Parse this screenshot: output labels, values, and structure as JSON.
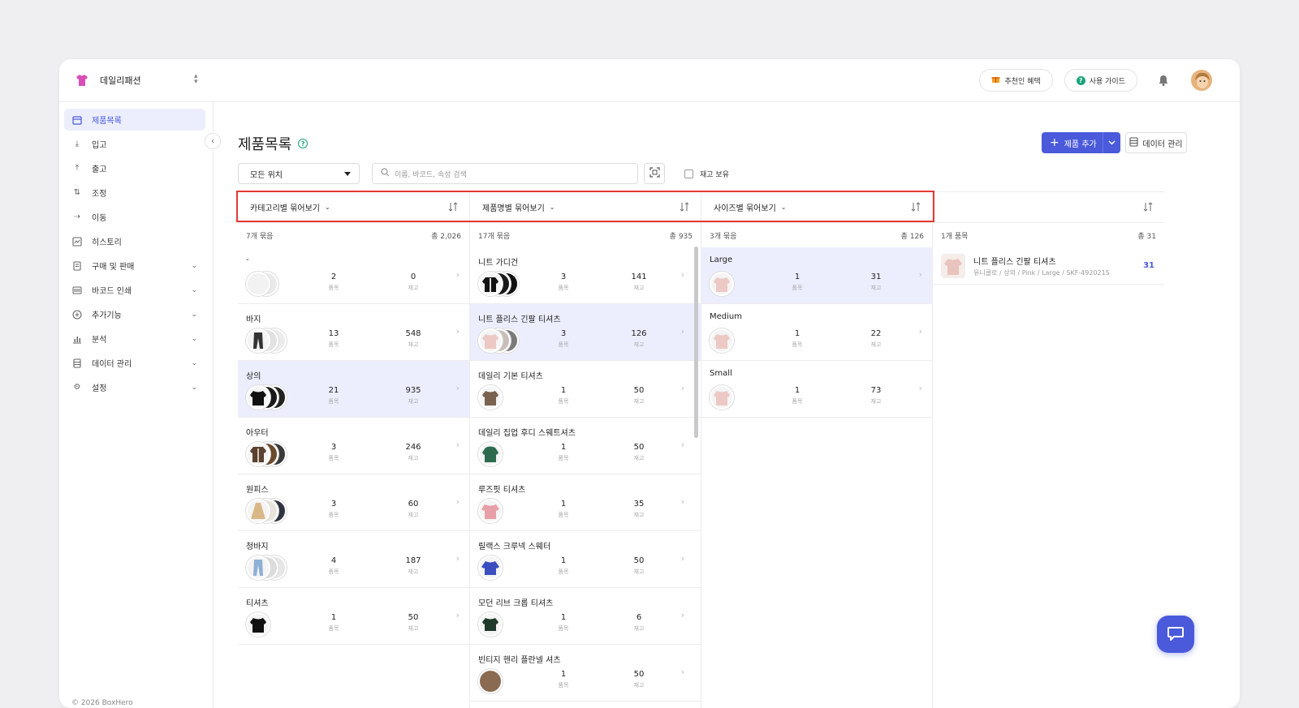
{
  "brand": {
    "name": "데일리패션"
  },
  "header": {
    "referral_label": "추천인 혜택",
    "guide_label": "사용 가이드"
  },
  "sidebar": {
    "items": [
      {
        "label": "제품목록",
        "icon": "box-icon"
      },
      {
        "label": "입고",
        "icon": "arrow-down-icon"
      },
      {
        "label": "출고",
        "icon": "arrow-up-icon"
      },
      {
        "label": "조정",
        "icon": "swap-icon"
      },
      {
        "label": "이동",
        "icon": "move-icon"
      },
      {
        "label": "히스토리",
        "icon": "history-icon"
      },
      {
        "label": "구매 및 판매",
        "icon": "document-icon"
      },
      {
        "label": "바코드 인쇄",
        "icon": "barcode-icon"
      },
      {
        "label": "추가기능",
        "icon": "plus-circle-icon"
      },
      {
        "label": "분석",
        "icon": "chart-icon"
      },
      {
        "label": "데이터 관리",
        "icon": "database-icon"
      },
      {
        "label": "설정",
        "icon": "gear-icon"
      }
    ],
    "copyright": "© 2026 BoxHero"
  },
  "page": {
    "title": "제품목록",
    "add_product_label": "제품 추가",
    "data_manage_label": "데이터 관리",
    "location_value": "모든 위치",
    "search_placeholder": "이름, 바코드, 속성 검색",
    "stock_only_label": "재고 보유"
  },
  "columns": {
    "category": {
      "header": "카테고리별 묶어보기",
      "count": "7개 묶음",
      "total": "총 2,026",
      "rows": [
        {
          "name": "-",
          "items": "2",
          "stock": "0"
        },
        {
          "name": "바지",
          "items": "13",
          "stock": "548"
        },
        {
          "name": "상의",
          "items": "21",
          "stock": "935"
        },
        {
          "name": "아우터",
          "items": "3",
          "stock": "246"
        },
        {
          "name": "원피스",
          "items": "3",
          "stock": "60"
        },
        {
          "name": "청바지",
          "items": "4",
          "stock": "187"
        },
        {
          "name": "티셔츠",
          "items": "1",
          "stock": "50"
        }
      ]
    },
    "product": {
      "header": "제품명별 묶어보기",
      "count": "17개 묶음",
      "total": "총 935",
      "rows": [
        {
          "name": "니트 가디건",
          "items": "3",
          "stock": "141"
        },
        {
          "name": "니트 플리스 긴팔 티셔츠",
          "items": "3",
          "stock": "126"
        },
        {
          "name": "데일리 기본 티셔츠",
          "items": "1",
          "stock": "50"
        },
        {
          "name": "데일리 집업 후디 스웨트셔츠",
          "items": "1",
          "stock": "50"
        },
        {
          "name": "루즈핏 티셔츠",
          "items": "1",
          "stock": "35"
        },
        {
          "name": "릴랙스 크루넥 스웨터",
          "items": "1",
          "stock": "50"
        },
        {
          "name": "모던 리브 크롭 티셔츠",
          "items": "1",
          "stock": "6"
        },
        {
          "name": "빈티지 헨리 플란넬 셔츠",
          "items": "1",
          "stock": "50"
        }
      ]
    },
    "size": {
      "header": "사이즈별 묶어보기",
      "count": "3개 묶음",
      "total": "총 126",
      "rows": [
        {
          "name": "Large",
          "items": "1",
          "stock": "31"
        },
        {
          "name": "Medium",
          "items": "1",
          "stock": "22"
        },
        {
          "name": "Small",
          "items": "1",
          "stock": "73"
        }
      ]
    },
    "items": {
      "count": "1개 품목",
      "total": "총 31",
      "rows": [
        {
          "name": "니트 플리스 긴팔 티셔츠",
          "meta": "유니클로 / 상의 / Pink / Large / SKF-4920215",
          "qty": "31"
        }
      ]
    }
  },
  "labels": {
    "items": "품목",
    "stock": "재고"
  },
  "colors": {
    "accent": "#4a5adb",
    "selected_row": "#eceefd",
    "highlight_box": "#e53935",
    "help": "#19a37a"
  }
}
